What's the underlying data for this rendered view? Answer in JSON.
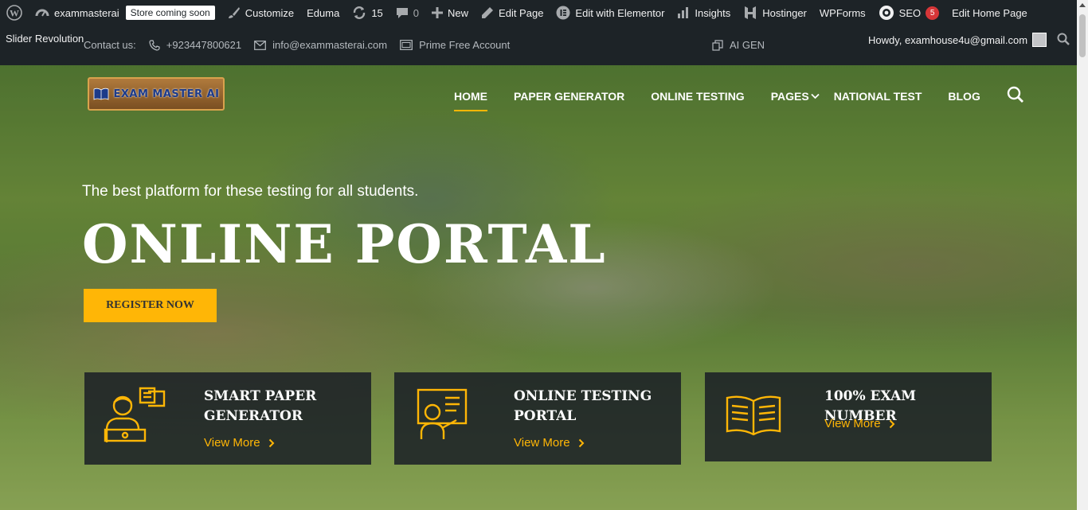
{
  "adminbar": {
    "site_name": "exammasterai",
    "store_badge": "Store coming soon",
    "customize": "Customize",
    "theme": "Eduma",
    "updates_count": "15",
    "comments_count": "0",
    "new": "New",
    "edit_page": "Edit Page",
    "edit_elementor": "Edit with Elementor",
    "insights": "Insights",
    "hostinger": "Hostinger",
    "wpforms": "WPForms",
    "seo": "SEO",
    "seo_count": "5",
    "edit_home": "Edit Home Page"
  },
  "topbar": {
    "slider_revolution": "Slider Revolution",
    "contact_label": "Contact us:",
    "phone": "+923447800621",
    "email": "info@exammasterai.com",
    "account": "Prime Free Account",
    "ai_gen": "AI GEN",
    "howdy": "Howdy, examhouse4u@gmail.com"
  },
  "logo": {
    "text": "EXAM MASTER AI"
  },
  "nav": {
    "items": [
      "HOME",
      "PAPER GENERATOR",
      "ONLINE TESTING",
      "PAGES",
      "NATIONAL TEST",
      "BLOG"
    ]
  },
  "hero": {
    "tagline": "The best platform for these testing for all students.",
    "headline": "ONLINE PORTAL",
    "register": "REGISTER NOW"
  },
  "cards": [
    {
      "title": "SMART PAPER GENERATOR",
      "more": "View More"
    },
    {
      "title": "ONLINE TESTING PORTAL",
      "more": "View More"
    },
    {
      "title": "100% EXAM NUMBER",
      "more": "View More"
    }
  ],
  "colors": {
    "accent": "#ffb606",
    "adminbar": "#1d2327",
    "badge_red": "#d63638"
  }
}
